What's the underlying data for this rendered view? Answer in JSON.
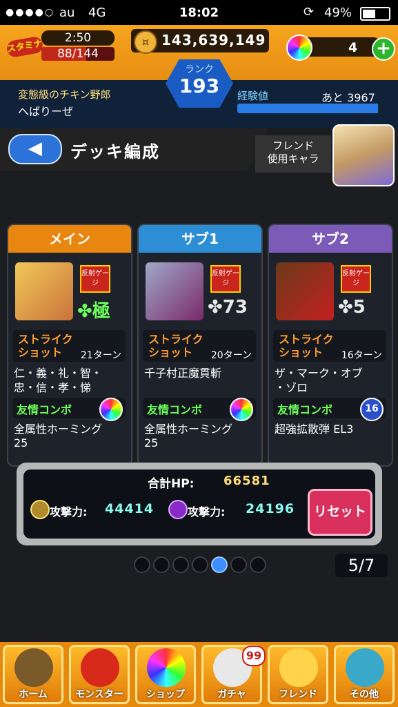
{
  "status_bar": {
    "signal": "●●●●○",
    "carrier": "au",
    "network": "4G",
    "time": "18:02",
    "battery": "49%"
  },
  "header": {
    "stamina_icon": "スタミナ",
    "stamina_timer": "2:50",
    "stamina": "88/144",
    "stamina_fraction": 0.61,
    "coins": "143,639,149",
    "orbs": "4",
    "plus": "+",
    "rank_label": "ランク",
    "rank": "193",
    "title_name": "変態級のチキン野郎",
    "player_name": "へばりーぜ",
    "exp_label": "経験値",
    "exp_next": "あと 3967",
    "exp_fraction": 0.97
  },
  "titlebar": {
    "back": "◀",
    "title": "デッキ編成",
    "friend_label": "フレンド\n使用キャラ"
  },
  "deck": [
    {
      "tab": "メイン",
      "tab_color": "#e8860f",
      "tag": "反射ゲージ",
      "luck": "極",
      "ss_label": "ストライク\nショット",
      "ss_turns": "21ターン",
      "ss_desc": "仁・義・礼・智・\n忠・信・孝・悌",
      "fc_label": "友情コンボ",
      "fc_desc": "全属性ホーミング\n25"
    },
    {
      "tab": "サブ1",
      "tab_color": "#2d8ed6",
      "tag": "反射ゲージ",
      "luck": "73",
      "ss_label": "ストライク\nショット",
      "ss_turns": "20ターン",
      "ss_desc": "千子村正魔貫斬",
      "fc_label": "友情コンボ",
      "fc_desc": "全属性ホーミング\n25"
    },
    {
      "tab": "サブ2",
      "tab_color": "#7c5ab8",
      "tag": "反射ゲージ",
      "luck": "5",
      "ss_label": "ストライク\nショット",
      "ss_turns": "16ターン",
      "ss_desc": "ザ・マーク・オブ\n・ゾロ",
      "fc_label": "友情コンボ",
      "fc_icon": "16",
      "fc_desc": "超強拡散弾 EL3"
    }
  ],
  "stats": {
    "hp_label": "合計HP:",
    "hp": "66581",
    "atk1_label": "攻撃力:",
    "atk1": "44414",
    "atk2_label": "攻撃力:",
    "atk2": "24196",
    "reset": "リセット"
  },
  "pager": {
    "count": "5/7",
    "total": 7,
    "active": 5
  },
  "nav": [
    {
      "label": "ホーム",
      "icon": "home-icon"
    },
    {
      "label": "モンスター",
      "icon": "monster-icon"
    },
    {
      "label": "ショップ",
      "icon": "orb-icon"
    },
    {
      "label": "ガチャ",
      "icon": "egg-icon",
      "badge": "99"
    },
    {
      "label": "フレンド",
      "icon": "friend-icon"
    },
    {
      "label": "その他",
      "icon": "other-icon"
    }
  ]
}
